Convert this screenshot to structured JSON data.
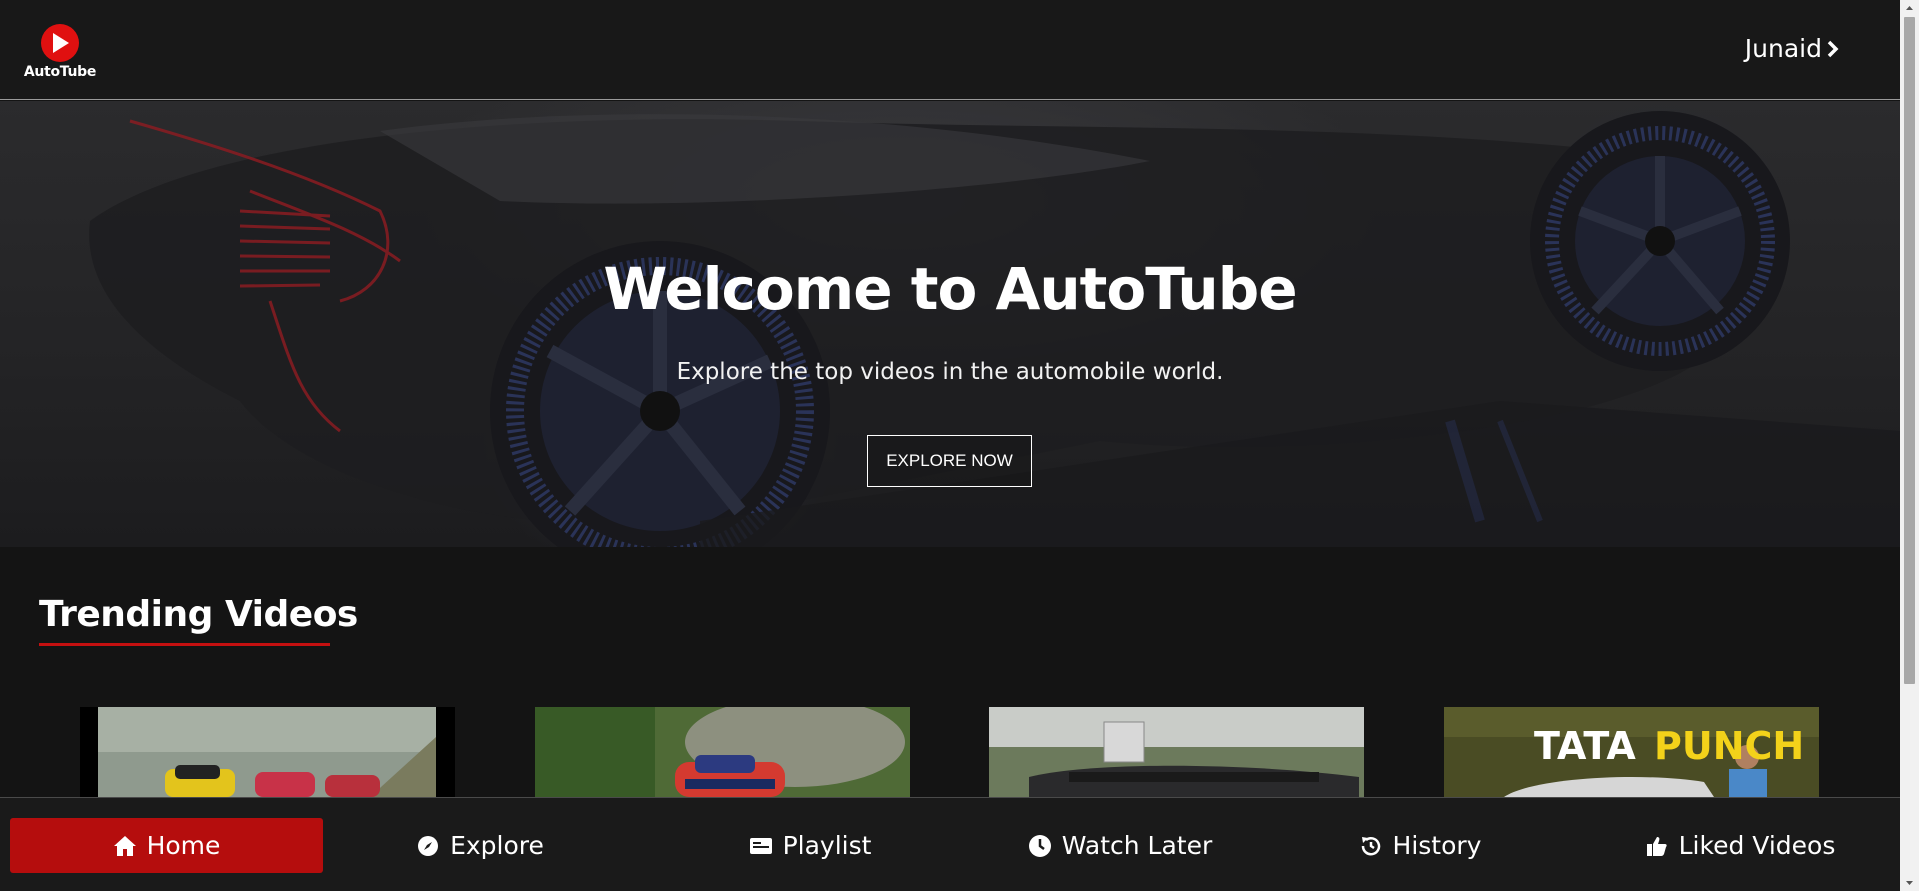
{
  "header": {
    "logo_text": "AutoTube",
    "user_name": "Junaid"
  },
  "hero": {
    "title": "Welcome to AutoTube",
    "subtitle": "Explore the top videos in the automobile world.",
    "button_label": "EXPLORE NOW"
  },
  "trending": {
    "title": "Trending Videos",
    "videos": [
      {
        "thumb_text": ""
      },
      {
        "thumb_text": ""
      },
      {
        "thumb_text": ""
      },
      {
        "thumb_text_white": "TATA ",
        "thumb_text_yellow": "PUNCH"
      }
    ]
  },
  "bottom_nav": {
    "items": [
      {
        "label": "Home",
        "icon": "home-icon",
        "active": true
      },
      {
        "label": "Explore",
        "icon": "compass-icon",
        "active": false
      },
      {
        "label": "Playlist",
        "icon": "playlist-icon",
        "active": false
      },
      {
        "label": "Watch Later",
        "icon": "clock-icon",
        "active": false
      },
      {
        "label": "History",
        "icon": "history-icon",
        "active": false
      },
      {
        "label": "Liked Videos",
        "icon": "thumbs-up-icon",
        "active": false
      }
    ]
  },
  "colors": {
    "accent": "#b50d0d",
    "logo_red": "#e01010",
    "background": "#141414"
  }
}
